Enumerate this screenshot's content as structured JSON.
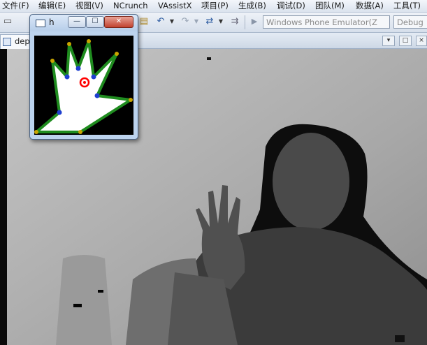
{
  "menu": {
    "items": [
      {
        "label": "文件(F)"
      },
      {
        "label": "编辑(E)"
      },
      {
        "label": "视图(V)"
      },
      {
        "label": "NCrunch"
      },
      {
        "label": "VAssistX"
      },
      {
        "label": "项目(P)"
      },
      {
        "label": "生成(B)"
      },
      {
        "label": "调试(D)"
      },
      {
        "label": "团队(M)"
      },
      {
        "label": "数据(A)"
      },
      {
        "label": "工具(T)"
      }
    ]
  },
  "toolbar": {
    "target_device": "Windows Phone Emulator(Z",
    "configuration": "Debug",
    "icons": [
      "undo-icon",
      "redo-icon",
      "navigate-icon",
      "start-debug-icon"
    ]
  },
  "tab": {
    "label": "dep"
  },
  "hand_window": {
    "title": "h",
    "minimize_glyph": "—",
    "maximize_glyph": "☐",
    "close_glyph": "✕"
  },
  "colors": {
    "hand_fill": "#ffffff",
    "hand_outline": "#1f8c1f",
    "joint": "#1f3fd0",
    "fingertip": "#c8a400",
    "palm_center": "#ff0000"
  }
}
